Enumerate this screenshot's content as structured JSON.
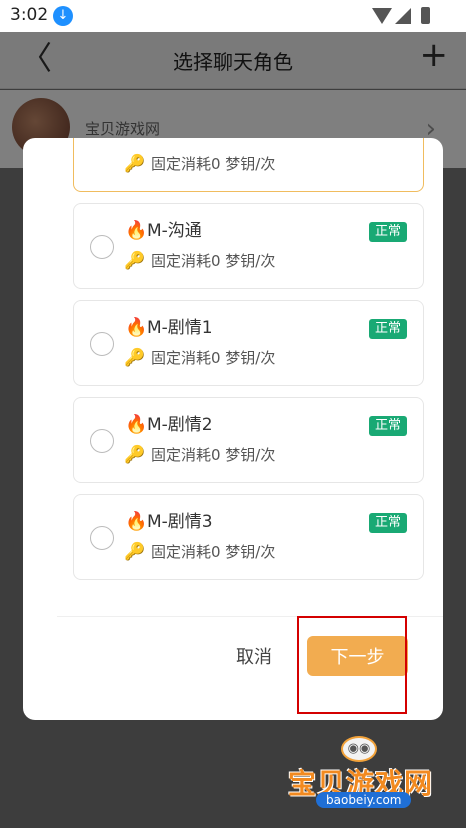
{
  "status_bar": {
    "time": "3:02"
  },
  "header": {
    "title": "选择聊天角色",
    "back": "〈",
    "add": "+"
  },
  "background_row": {
    "name": "宝贝游戏网",
    "chevron": "›"
  },
  "dialog": {
    "roles": [
      {
        "name": "",
        "cost": "固定消耗0 梦钥/次",
        "status": "",
        "selected": true,
        "partial": true
      },
      {
        "name": "M-沟通",
        "cost": "固定消耗0 梦钥/次",
        "status": "正常",
        "selected": false
      },
      {
        "name": "M-剧情1",
        "cost": "固定消耗0 梦钥/次",
        "status": "正常",
        "selected": false
      },
      {
        "name": "M-剧情2",
        "cost": "固定消耗0 梦钥/次",
        "status": "正常",
        "selected": false
      },
      {
        "name": "M-剧情3",
        "cost": "固定消耗0 梦钥/次",
        "status": "正常",
        "selected": false
      }
    ],
    "cancel_label": "取消",
    "next_label": "下一步"
  },
  "watermark": {
    "text": "宝贝游戏网",
    "url": "baobeiy.com"
  },
  "icons": {
    "download": "download-icon",
    "wifi": "wifi-icon",
    "signal": "signal-icon",
    "battery": "battery-icon",
    "fire": "fire-icon",
    "key": "key-icon"
  },
  "colors": {
    "badge": "#19a974",
    "next_button": "#f2ac50",
    "selected_border": "#f0bc5e",
    "highlight": "#d40000"
  }
}
